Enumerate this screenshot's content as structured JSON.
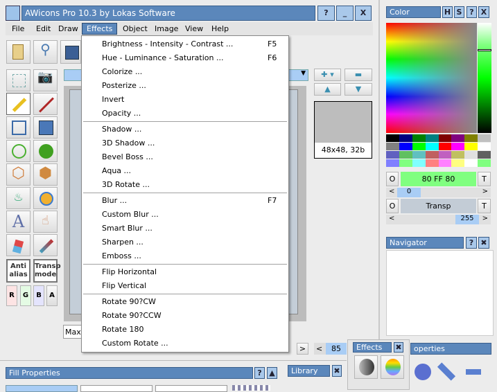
{
  "window": {
    "title": "AWicons Pro 10.3 by Lokas Software",
    "buttons": [
      "?",
      "_",
      "X"
    ]
  },
  "menubar": [
    "File",
    "Edit",
    "Draw",
    "Effects",
    "Object",
    "Image",
    "View",
    "Help"
  ],
  "effects_menu": {
    "groups": [
      [
        {
          "label": "Brightness - Intensity - Contrast ...",
          "shortcut": "F5"
        },
        {
          "label": "Hue - Luminance - Saturation ...",
          "shortcut": "F6"
        },
        {
          "label": "Colorize ..."
        },
        {
          "label": "Posterize ..."
        },
        {
          "label": "Invert"
        },
        {
          "label": "Opacity ..."
        }
      ],
      [
        {
          "label": "Shadow ..."
        },
        {
          "label": "3D Shadow ..."
        },
        {
          "label": "Bevel Boss ..."
        },
        {
          "label": "Aqua ..."
        },
        {
          "label": "3D Rotate ..."
        }
      ],
      [
        {
          "label": "Blur ...",
          "shortcut": "F7"
        },
        {
          "label": "Custom Blur ..."
        },
        {
          "label": "Smart Blur ..."
        },
        {
          "label": "Sharpen ..."
        },
        {
          "label": "Emboss ..."
        }
      ],
      [
        {
          "label": "Flip Horizontal"
        },
        {
          "label": "Flip Vertical"
        }
      ],
      [
        {
          "label": "Rotate 90?CW"
        },
        {
          "label": "Rotate 90?CCW"
        },
        {
          "label": "Rotate 180"
        },
        {
          "label": "Custom Rotate ..."
        }
      ]
    ]
  },
  "toolbox": {
    "antialias": "Anti alias",
    "transp": "Transp mode",
    "channels": [
      "R",
      "G",
      "B",
      "A"
    ]
  },
  "canvas": {
    "zoom_field": "Max",
    "scroll_value": "85"
  },
  "preview": {
    "label": "48x48, 32b"
  },
  "color_panel": {
    "title": "Color",
    "buttons": [
      "H",
      "S",
      "?",
      "X"
    ],
    "color_value": "80 FF 80",
    "slider1": "0",
    "transp_label": "Transp",
    "slider2": "255",
    "o": "O",
    "t": "T",
    "palette": [
      "#000000",
      "#000080",
      "#008000",
      "#008080",
      "#800000",
      "#800080",
      "#808000",
      "#c0c0c0",
      "#808080",
      "#0000ff",
      "#00ff00",
      "#00ffff",
      "#ff0000",
      "#ff00ff",
      "#ffff00",
      "#ffffff",
      "#6060c0",
      "#60c060",
      "#60c0c0",
      "#c06060",
      "#c060c0",
      "#c0c060",
      "#e0e0e0",
      "#606060",
      "#8080ff",
      "#80ff80",
      "#80ffff",
      "#ff8080",
      "#ff80ff",
      "#ffff80",
      "#ffffff",
      "#80ff80"
    ],
    "current_color": "#80ff80"
  },
  "navigator": {
    "title": "Navigator"
  },
  "effects_panel": {
    "title": "Effects"
  },
  "properties_panel": {
    "title": "operties"
  },
  "fill_properties": {
    "title": "Fill Properties"
  },
  "library": {
    "title": "Library"
  }
}
